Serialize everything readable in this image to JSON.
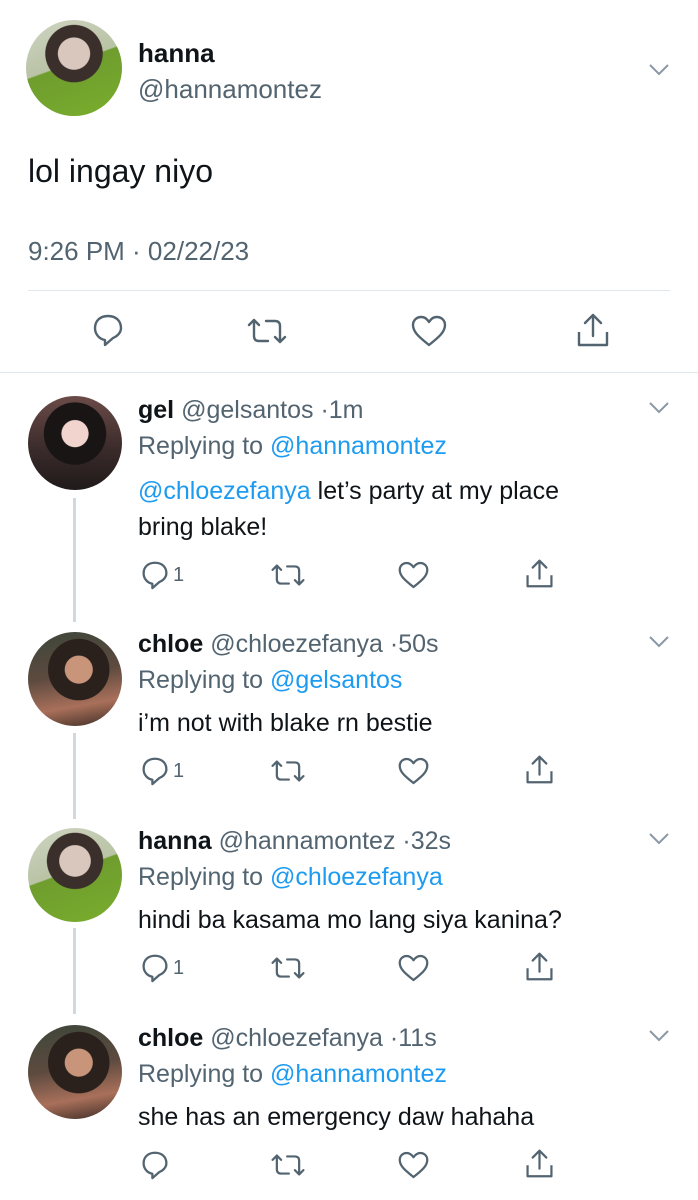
{
  "main_tweet": {
    "name": "hanna",
    "handle": "@hannamontez",
    "text": "lol ingay niyo",
    "timestamp": "9:26 PM · 02/22/23"
  },
  "replies": [
    {
      "name": "gel",
      "handle": "@gelsantos",
      "dot": "·",
      "time": "1m",
      "replying_label": "Replying to",
      "replying_to": "@hannamontez",
      "mention": "@chloezefanya",
      "text_line1": " let’s party at my place",
      "text_line2": "bring blake!",
      "reply_count": "1"
    },
    {
      "name": "chloe",
      "handle": "@chloezefanya",
      "dot": "·",
      "time": "50s",
      "replying_label": "Replying to",
      "replying_to": "@gelsantos",
      "text": "i’m not with blake rn bestie",
      "reply_count": "1"
    },
    {
      "name": "hanna",
      "handle": "@hannamontez",
      "dot": "·",
      "time": "32s",
      "replying_label": "Replying to",
      "replying_to": "@chloezefanya",
      "text": "hindi ba kasama mo lang siya kanina?",
      "reply_count": "1"
    },
    {
      "name": "chloe",
      "handle": "@chloezefanya",
      "dot": "·",
      "time": "11s",
      "replying_label": "Replying to",
      "replying_to": "@hannamontez",
      "text": "she has an emergency daw hahaha",
      "reply_count": ""
    }
  ],
  "colors": {
    "accent": "#1d9bf0",
    "secondary_text": "#536471",
    "primary_text": "#0f1419",
    "divider": "#e1e8ed"
  },
  "icons": [
    "chevron-down-icon",
    "reply-icon",
    "retweet-icon",
    "like-icon",
    "share-icon"
  ]
}
